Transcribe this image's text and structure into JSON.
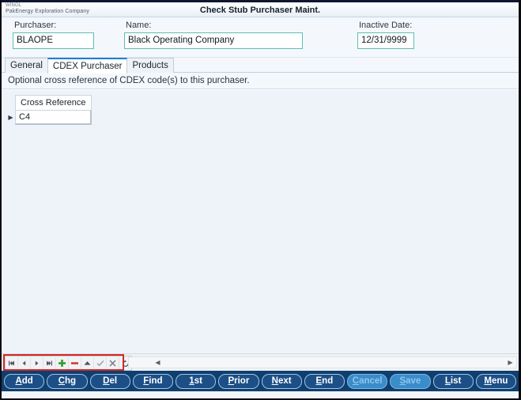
{
  "window": {
    "title": "Check Stub Purchaser Maint.",
    "brand_product": "WINGL",
    "brand_company": "PakEnergy Exploration Company"
  },
  "form": {
    "purchaser": {
      "label": "Purchaser:",
      "value": "BLAOPE",
      "placeholder": ""
    },
    "name": {
      "label": "Name:",
      "value": "Black Operating Company",
      "placeholder": ""
    },
    "inactive_date": {
      "label": "Inactive Date:",
      "value": "12/31/9999",
      "placeholder": ""
    },
    "input_border_color": "#5bbfb5"
  },
  "tabs": [
    {
      "label": "General",
      "active": false
    },
    {
      "label": "CDEX Purchaser",
      "active": true
    },
    {
      "label": "Products",
      "active": false
    }
  ],
  "description": "Optional cross reference of CDEX code(s) to this purchaser.",
  "grid": {
    "columns": [
      "Cross Reference"
    ],
    "rows": [
      {
        "indicator": "▶",
        "cells": [
          "C4"
        ]
      }
    ]
  },
  "navigator": {
    "highlight_color": "#d62828",
    "buttons": [
      {
        "name": "first-record",
        "glyph": "first"
      },
      {
        "name": "prior-record",
        "glyph": "prev"
      },
      {
        "name": "next-record",
        "glyph": "next"
      },
      {
        "name": "last-record",
        "glyph": "last"
      },
      {
        "name": "insert-record",
        "glyph": "plus",
        "color": "#2f9e2f"
      },
      {
        "name": "delete-record",
        "glyph": "minus",
        "color": "#d33a3a"
      },
      {
        "name": "edit-record",
        "glyph": "up",
        "color": "#4b5560"
      },
      {
        "name": "post-edit",
        "glyph": "check",
        "color": "#7f8a96"
      },
      {
        "name": "cancel-edit",
        "glyph": "cross",
        "color": "#6b757f"
      },
      {
        "name": "refresh-record",
        "glyph": "refresh",
        "color": "#4b5560"
      }
    ],
    "scroll_left_glyph": "◀",
    "scroll_right_glyph": "▶"
  },
  "actions": [
    {
      "label": "Add",
      "accel": "A",
      "disabled": false
    },
    {
      "label": "Chg",
      "accel": "C",
      "disabled": false
    },
    {
      "label": "Del",
      "accel": "D",
      "disabled": false
    },
    {
      "label": "Find",
      "accel": "F",
      "disabled": false
    },
    {
      "label": "1st",
      "accel": "1",
      "disabled": false
    },
    {
      "label": "Prior",
      "accel": "P",
      "disabled": false
    },
    {
      "label": "Next",
      "accel": "N",
      "disabled": false
    },
    {
      "label": "End",
      "accel": "E",
      "disabled": false
    },
    {
      "label": "Cancel",
      "accel": "C",
      "disabled": true
    },
    {
      "label": "Save",
      "accel": "S",
      "disabled": true
    },
    {
      "label": "List",
      "accel": "L",
      "disabled": false
    },
    {
      "label": "Menu",
      "accel": "M",
      "disabled": false
    }
  ]
}
